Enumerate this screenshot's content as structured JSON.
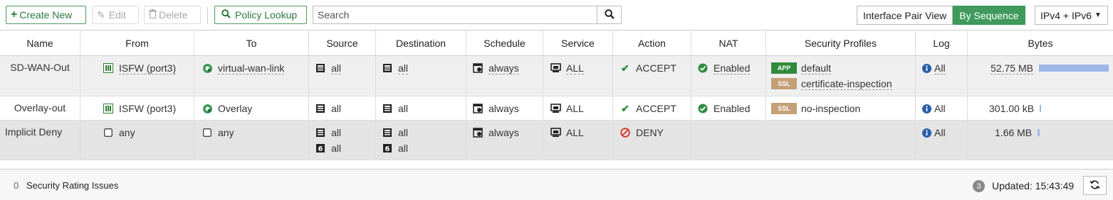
{
  "toolbar": {
    "create_label": "Create New",
    "edit_label": "Edit",
    "delete_label": "Delete",
    "lookup_label": "Policy Lookup",
    "search_placeholder": "Search",
    "view_pair_label": "Interface Pair View",
    "view_seq_label": "By Sequence",
    "ip_version": "IPv4 + IPv6"
  },
  "table": {
    "columns": [
      "Name",
      "From",
      "To",
      "Source",
      "Destination",
      "Schedule",
      "Service",
      "Action",
      "NAT",
      "Security Profiles",
      "Log",
      "Bytes"
    ],
    "rows": [
      {
        "name": "SD-WAN-Out",
        "from": "ISFW (port3)",
        "to": "virtual-wan-link",
        "source": "all",
        "destination": "all",
        "schedule": "always",
        "service": "ALL",
        "action": "ACCEPT",
        "nat": "Enabled",
        "profiles": [
          {
            "tag": "APP",
            "name": "default"
          },
          {
            "tag": "SSL",
            "name": "certificate-inspection"
          }
        ],
        "log": "All",
        "bytes": "52.75 MB",
        "bytes_fraction": 1.0
      },
      {
        "name": "Overlay-out",
        "from": "ISFW (port3)",
        "to": "Overlay",
        "source": "all",
        "destination": "all",
        "schedule": "always",
        "service": "ALL",
        "action": "ACCEPT",
        "nat": "Enabled",
        "profiles": [
          {
            "tag": "SSL",
            "name": "no-inspection"
          }
        ],
        "log": "All",
        "bytes": "301.00 kB",
        "bytes_fraction": 0.02
      },
      {
        "name": "Implicit Deny",
        "from": "any",
        "to": "any",
        "source": "all",
        "source_v6": "all",
        "destination": "all",
        "destination_v6": "all",
        "schedule": "always",
        "service": "ALL",
        "action": "DENY",
        "log": "All",
        "bytes": "1.66 MB",
        "bytes_fraction": 0.03
      }
    ]
  },
  "footer": {
    "issues_count": "0",
    "issues_label": "Security Rating Issues",
    "badge_count": "3",
    "updated": "Updated: 15:43:49"
  },
  "colors": {
    "accent_green": "#3f9a5c",
    "accept_green": "#2e8b3e",
    "deny_red": "#d93025",
    "info_blue": "#2a5fa8",
    "bytes_bar": "#9db8e8",
    "app_tag": "#2f8a3c",
    "ssl_tag": "#c4a077"
  },
  "icons": [
    "plus-icon",
    "pencil-icon",
    "trash-icon",
    "search-icon",
    "interface-icon",
    "sdwan-icon",
    "address-icon",
    "address-v6-icon",
    "schedule-icon",
    "service-icon",
    "check-icon",
    "deny-icon",
    "check-circle-icon",
    "info-icon",
    "checkbox-icon",
    "refresh-icon"
  ]
}
